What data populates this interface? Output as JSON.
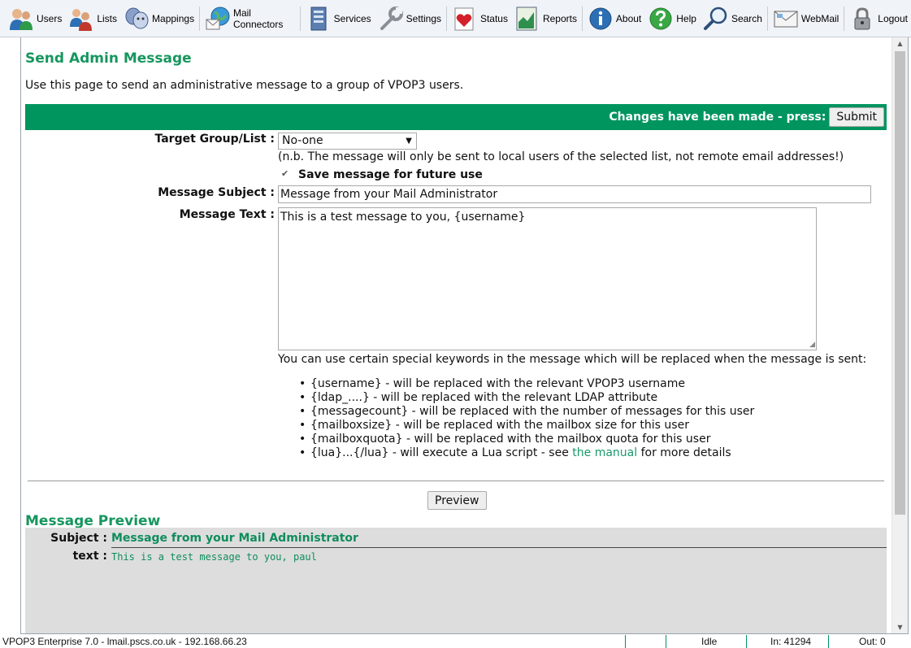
{
  "toolbar": {
    "items": [
      {
        "label": "Users",
        "icon": "users-icon"
      },
      {
        "label": "Lists",
        "icon": "lists-icon"
      },
      {
        "label": "Mappings",
        "icon": "mappings-icon"
      },
      {
        "label": "Mail Connectors",
        "icon": "mail-connectors-icon"
      },
      {
        "label": "Services",
        "icon": "services-icon"
      },
      {
        "label": "Settings",
        "icon": "settings-icon"
      },
      {
        "label": "Status",
        "icon": "status-icon"
      },
      {
        "label": "Reports",
        "icon": "reports-icon"
      },
      {
        "label": "About",
        "icon": "about-icon"
      },
      {
        "label": "Help",
        "icon": "help-icon"
      },
      {
        "label": "Search",
        "icon": "search-icon"
      },
      {
        "label": "WebMail",
        "icon": "webmail-icon"
      },
      {
        "label": "Logout",
        "icon": "logout-icon"
      }
    ]
  },
  "page": {
    "title": "Send Admin Message",
    "intro": "Use this page to send an administrative message to a group of VPOP3 users.",
    "changes_text": "Changes have been made - press:",
    "submit_label": "Submit"
  },
  "form": {
    "target_label": "Target Group/List :",
    "target_value": "No-one",
    "target_note": "(n.b. The message will only be sent to local users of the selected list, not remote email addresses!)",
    "save_label": "Save message for future use",
    "save_checked": true,
    "subject_label": "Message Subject :",
    "subject_value": "Message from your Mail Administrator",
    "text_label": "Message Text :",
    "text_value": "This is a test message to you, {username}"
  },
  "keywords": {
    "intro": "You can use certain special keywords in the message which will be replaced when the message is sent:",
    "items": [
      "{username} - will be replaced with the relevant VPOP3 username",
      "{ldap_....} - will be replaced with the relevant LDAP attribute",
      "{messagecount} - will be replaced with the number of messages for this user",
      "{mailboxsize} - will be replaced with the mailbox size for this user",
      "{mailboxquota} - will be replaced with the mailbox quota for this user"
    ],
    "lua_prefix": "{lua}...{/lua} - will execute a Lua script - see ",
    "lua_link": "the manual",
    "lua_suffix": " for more details"
  },
  "preview": {
    "button_label": "Preview",
    "title": "Message Preview",
    "subject_label": "Subject :",
    "subject_value": "Message from your Mail Administrator",
    "text_label": "text :",
    "text_value": "This is a test message to you, paul"
  },
  "statusbar": {
    "app": "VPOP3 Enterprise 7.0 - lmail.pscs.co.uk - 192.168.66.23",
    "state": "Idle",
    "in": "In: 41294",
    "out": "Out: 0"
  },
  "colors": {
    "accent_green": "#00955f",
    "heading_green": "#16965e",
    "toolbar_bg": "#f0f3f8"
  }
}
